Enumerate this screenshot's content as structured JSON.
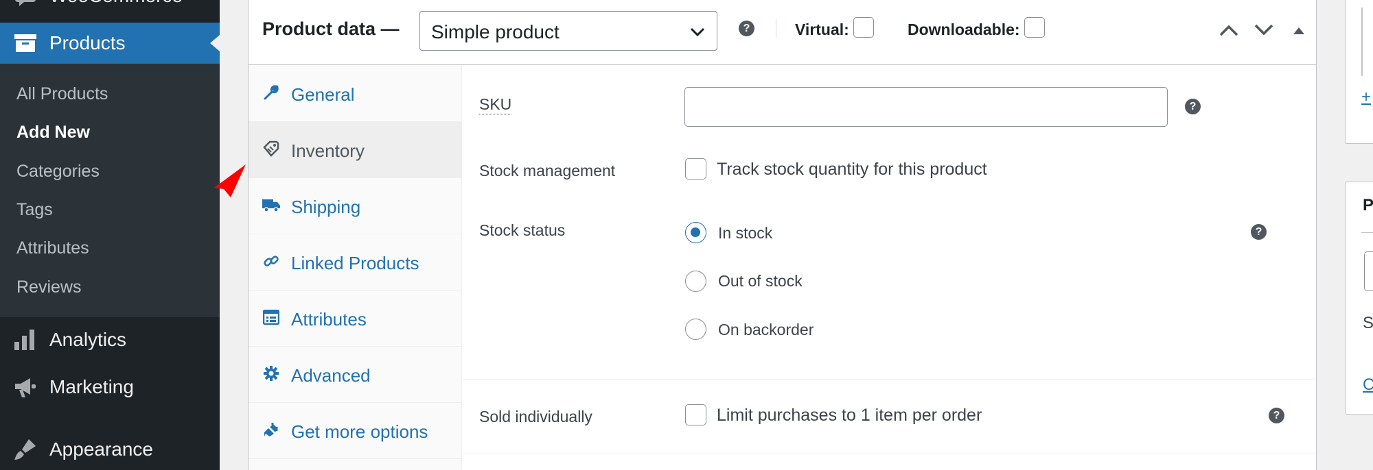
{
  "sidebar": {
    "woocommerce_label": "WooCommerce",
    "products_label": "Products",
    "submenu": [
      {
        "label": "All Products"
      },
      {
        "label": "Add New"
      },
      {
        "label": "Categories"
      },
      {
        "label": "Tags"
      },
      {
        "label": "Attributes"
      },
      {
        "label": "Reviews"
      }
    ],
    "analytics_label": "Analytics",
    "marketing_label": "Marketing",
    "appearance_label": "Appearance"
  },
  "product_data": {
    "title": "Product data —",
    "product_type": "Simple product",
    "virtual_label": "Virtual:",
    "downloadable_label": "Downloadable:",
    "virtual_checked": false,
    "downloadable_checked": false
  },
  "tabs": [
    {
      "label": "General",
      "icon": "wrench-icon"
    },
    {
      "label": "Inventory",
      "icon": "tag-icon",
      "active": true
    },
    {
      "label": "Shipping",
      "icon": "truck-icon"
    },
    {
      "label": "Linked Products",
      "icon": "link-icon"
    },
    {
      "label": "Attributes",
      "icon": "list-icon"
    },
    {
      "label": "Advanced",
      "icon": "gear-icon"
    },
    {
      "label": "Get more options",
      "icon": "plugin-icon"
    }
  ],
  "inventory": {
    "sku_label": "SKU",
    "sku_value": "",
    "stock_management_label": "Stock management",
    "track_stock_label": "Track stock quantity for this product",
    "stock_status_label": "Stock status",
    "stock_options": [
      {
        "label": "In stock",
        "selected": true
      },
      {
        "label": "Out of stock",
        "selected": false
      },
      {
        "label": "On backorder",
        "selected": false
      }
    ],
    "sold_individually_label": "Sold individually",
    "limit_label": "Limit purchases to 1 item per order"
  },
  "help_glyph": "?",
  "side_fragments": {
    "plus": "+",
    "letter_p": "P",
    "letter_s": "S",
    "letter_c": "C"
  },
  "colors": {
    "sidebar_bg": "#1d2327",
    "submenu_bg": "#2c3338",
    "accent": "#2271b1",
    "pointer": "#ff0000"
  }
}
